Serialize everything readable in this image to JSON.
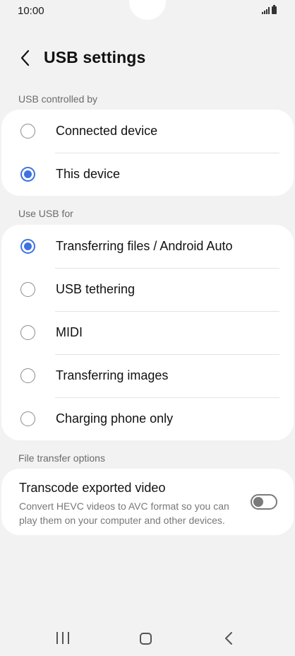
{
  "status_bar": {
    "time": "10:00"
  },
  "header": {
    "title": "USB settings",
    "back_icon": "chevron-left-icon"
  },
  "usb_controlled_by": {
    "label": "USB controlled by",
    "options": [
      {
        "label": "Connected device",
        "selected": false
      },
      {
        "label": "This device",
        "selected": true
      }
    ]
  },
  "use_usb_for": {
    "label": "Use USB for",
    "options": [
      {
        "label": "Transferring files / Android Auto",
        "selected": true
      },
      {
        "label": "USB tethering",
        "selected": false
      },
      {
        "label": "MIDI",
        "selected": false
      },
      {
        "label": "Transferring images",
        "selected": false
      },
      {
        "label": "Charging phone only",
        "selected": false
      }
    ]
  },
  "file_transfer_options": {
    "label": "File transfer options",
    "transcode": {
      "title": "Transcode exported video",
      "description": "Convert HEVC videos to AVC format so you can play them on your computer and other devices.",
      "enabled": false
    }
  },
  "colors": {
    "accent": "#3e73e0",
    "background": "#f2f2f2",
    "card": "#ffffff"
  }
}
